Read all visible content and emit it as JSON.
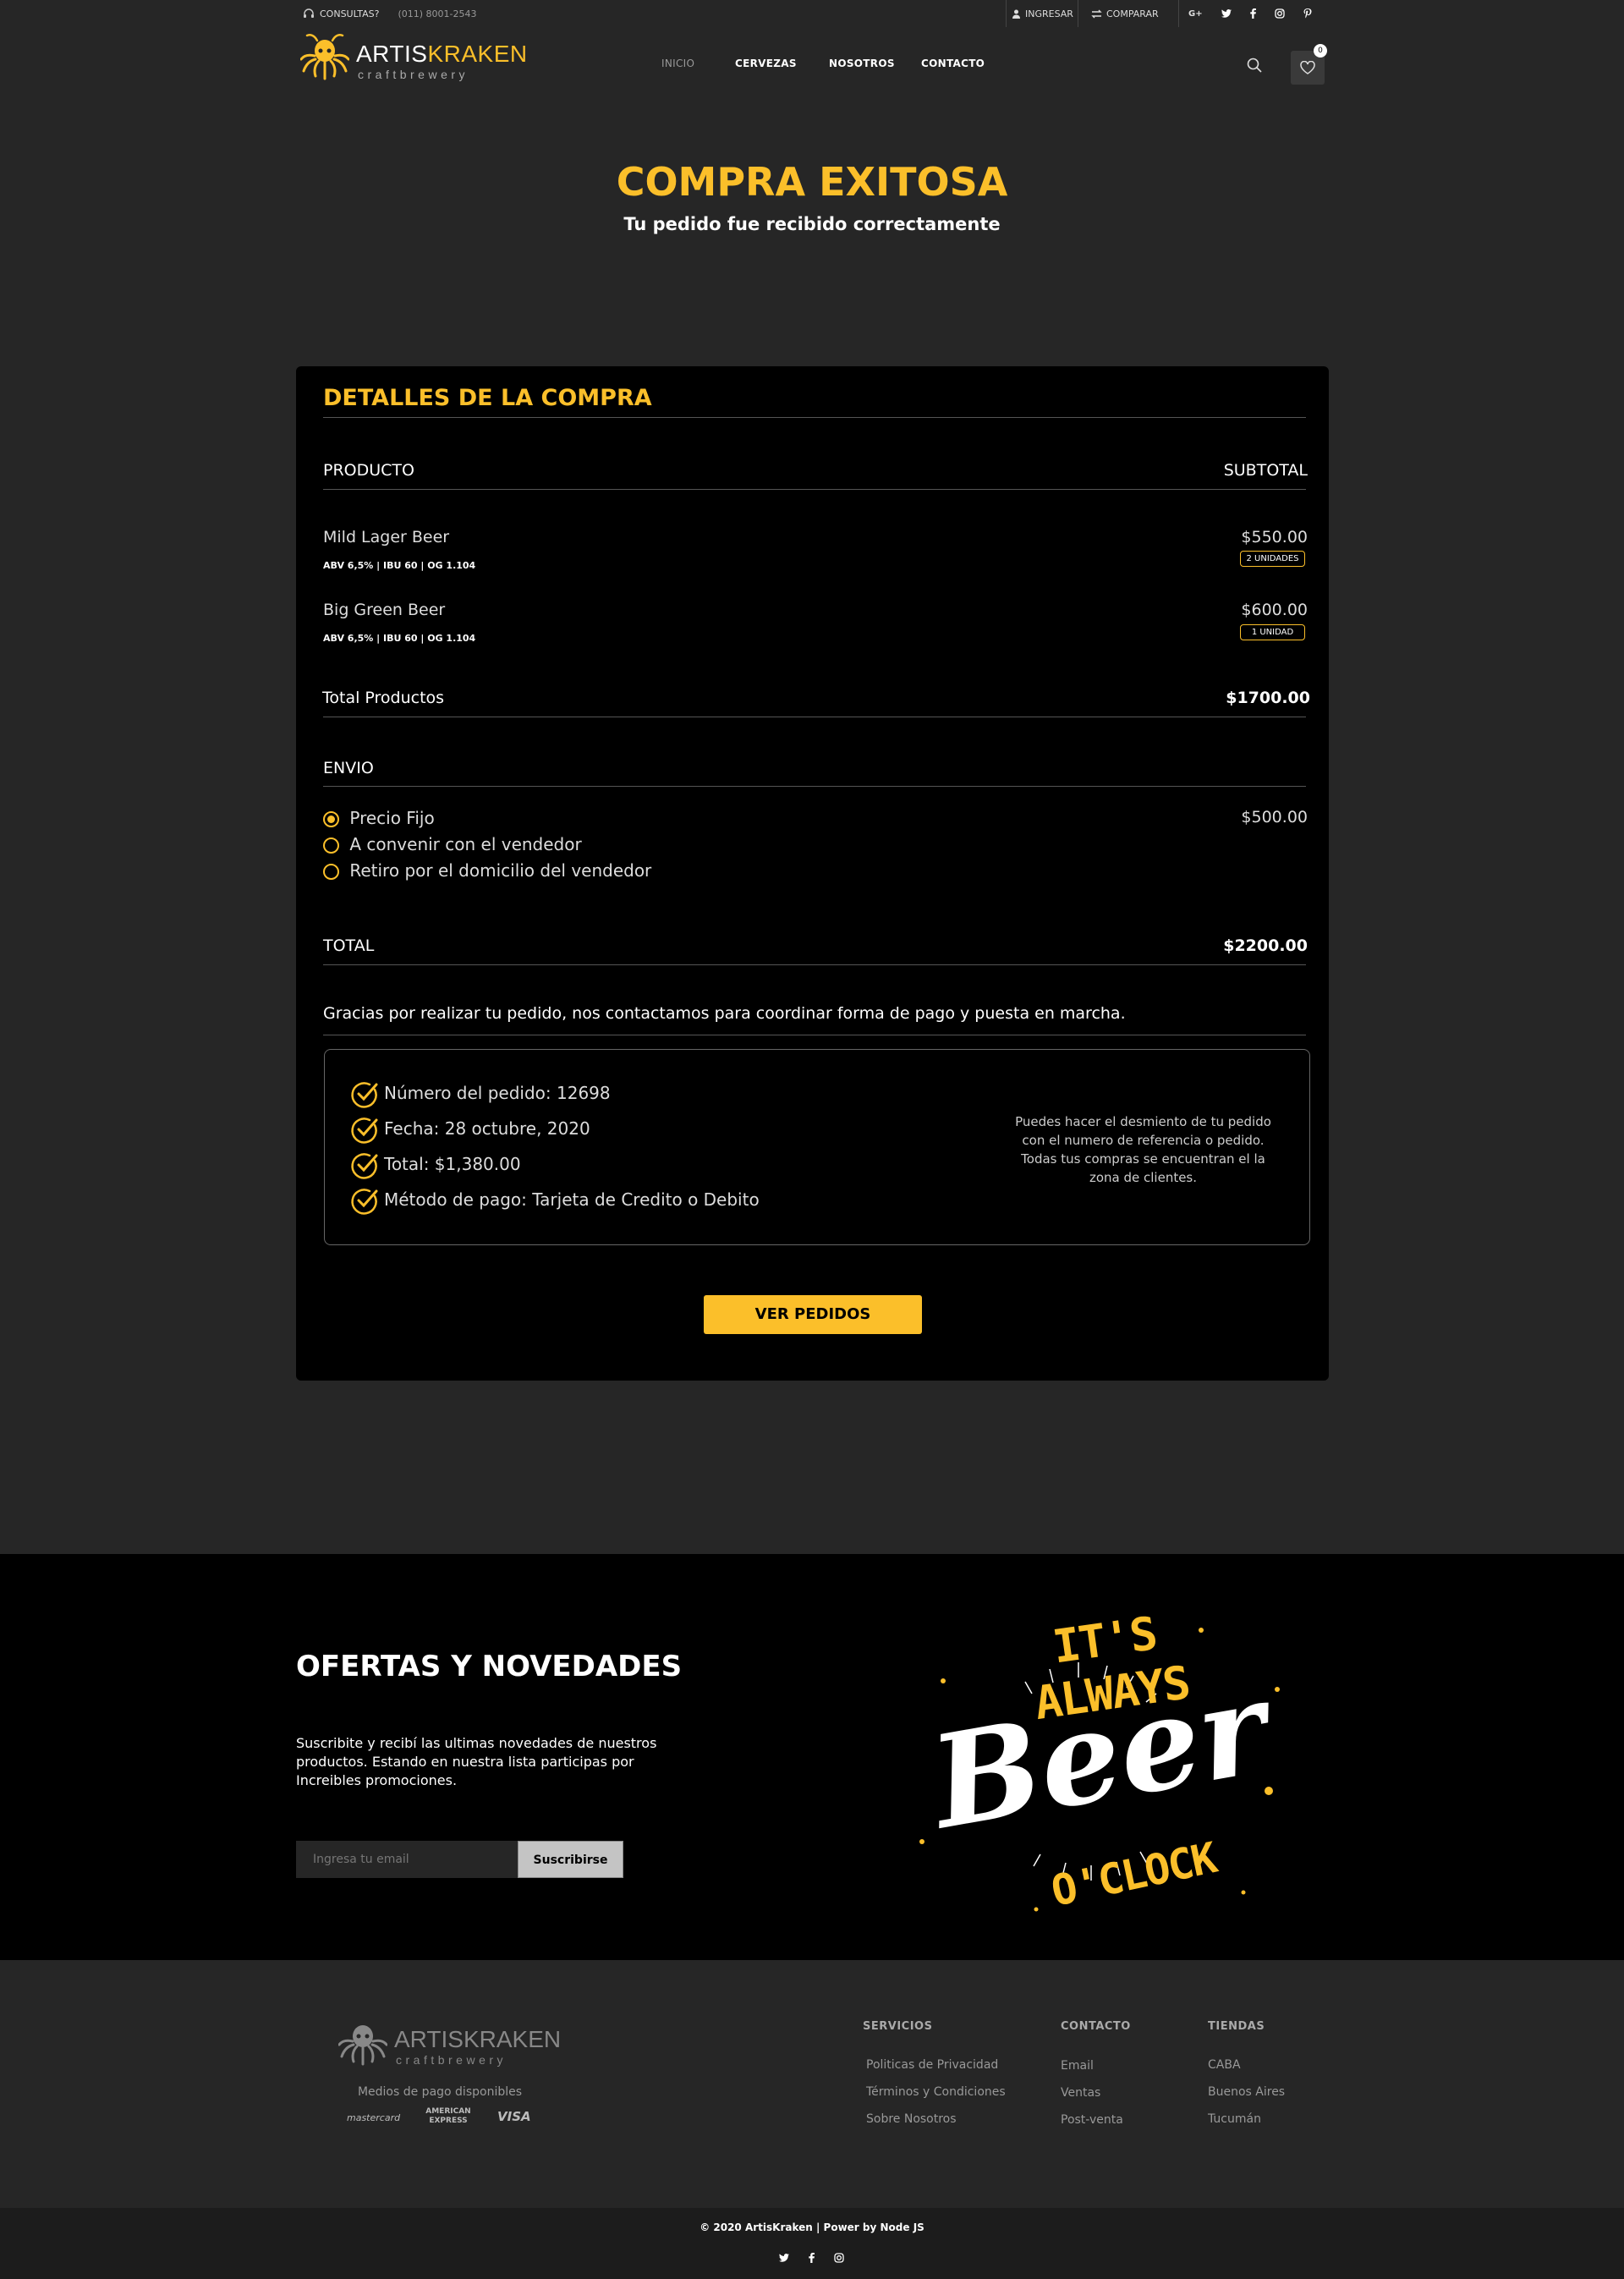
{
  "topbar": {
    "consultas": "CONSULTAS?",
    "phone": "(011) 8001-2543",
    "ingresar": "INGRESAR",
    "comparar": "COMPARAR",
    "social": [
      "G+",
      "twitter-icon",
      "facebook-icon",
      "instagram-icon",
      "pinterest-icon"
    ]
  },
  "brand": {
    "name_part1": "ARTIS",
    "name_part2": "KRAKEN",
    "tagline": "craftbrewery"
  },
  "nav": [
    "INICIO",
    "CERVEZAS",
    "NOSOTROS",
    "CONTACTO"
  ],
  "cart_count": "0",
  "hero": {
    "title": "COMPRA EXITOSA",
    "subtitle": "Tu pedido fue recibido correctamente"
  },
  "details": {
    "title": "DETALLES DE LA COMPRA",
    "col_product": "PRODUCTO",
    "col_subtotal": "SUBTOTAL",
    "items": [
      {
        "name": "Mild Lager Beer",
        "spec": "ABV 6,5% | IBU 60 | OG 1.104",
        "price": "$550.00",
        "qty": "2 UNIDADES"
      },
      {
        "name": "Big Green Beer",
        "spec": "ABV 6,5% | IBU 60 | OG 1.104",
        "price": "$600.00",
        "qty": "1 UNIDAD"
      }
    ],
    "total_products_label": "Total Productos",
    "total_products_value": "$1700.00",
    "envio_label": "ENVIO",
    "shipping": [
      {
        "label": "Precio Fijo",
        "selected": true,
        "price": "$500.00"
      },
      {
        "label": "A convenir con el vendedor",
        "selected": false
      },
      {
        "label": "Retiro por el domicilio del vendedor",
        "selected": false
      }
    ],
    "total_label": "TOTAL",
    "total_value": "$2200.00",
    "thanks": "Gracias por realizar tu pedido, nos contactamos para coordinar forma de pago y puesta en marcha.",
    "order_info": [
      "Número del pedido: 12698",
      "Fecha: 28 octubre, 2020",
      "Total: $1,380.00",
      "Método de pago: Tarjeta de Credito o Debito"
    ],
    "side_note": "Puedes hacer el desmiento de tu pedido con el numero de referencia o pedido. Todas tus compras se encuentran el la zona de clientes.",
    "button": "VER PEDIDOS"
  },
  "newsletter": {
    "title": "OFERTAS Y NOVEDADES",
    "text": "Suscribite y recibí las ultimas novedades de nuestros productos. Estando en nuestra lista participas por Increibles promociones.",
    "placeholder": "Ingresa tu email",
    "button": "Suscribirse"
  },
  "artwork": {
    "top": "IT'S ALWAYS",
    "middle": "Beer",
    "bottom": "O'CLOCK"
  },
  "footer": {
    "payments_label": "Medios de pago disponibles",
    "payments": [
      "mastercard",
      "AMERICAN EXPRESS",
      "VISA"
    ],
    "servicios_title": "SERVICIOS",
    "servicios": [
      "Politicas de Privacidad",
      "Términos y Condiciones",
      "Sobre Nosotros"
    ],
    "contacto_title": "CONTACTO",
    "contacto": [
      "Email",
      "Ventas",
      "Post-venta"
    ],
    "tiendas_title": "TIENDAS",
    "tiendas": [
      "CABA",
      "Buenos Aires",
      "Tucumán"
    ],
    "copyright": "© 2020 ArtisKraken | Power by Node JS"
  },
  "colors": {
    "accent": "#fbbf2a",
    "bg": "#262626",
    "card": "#000000"
  }
}
